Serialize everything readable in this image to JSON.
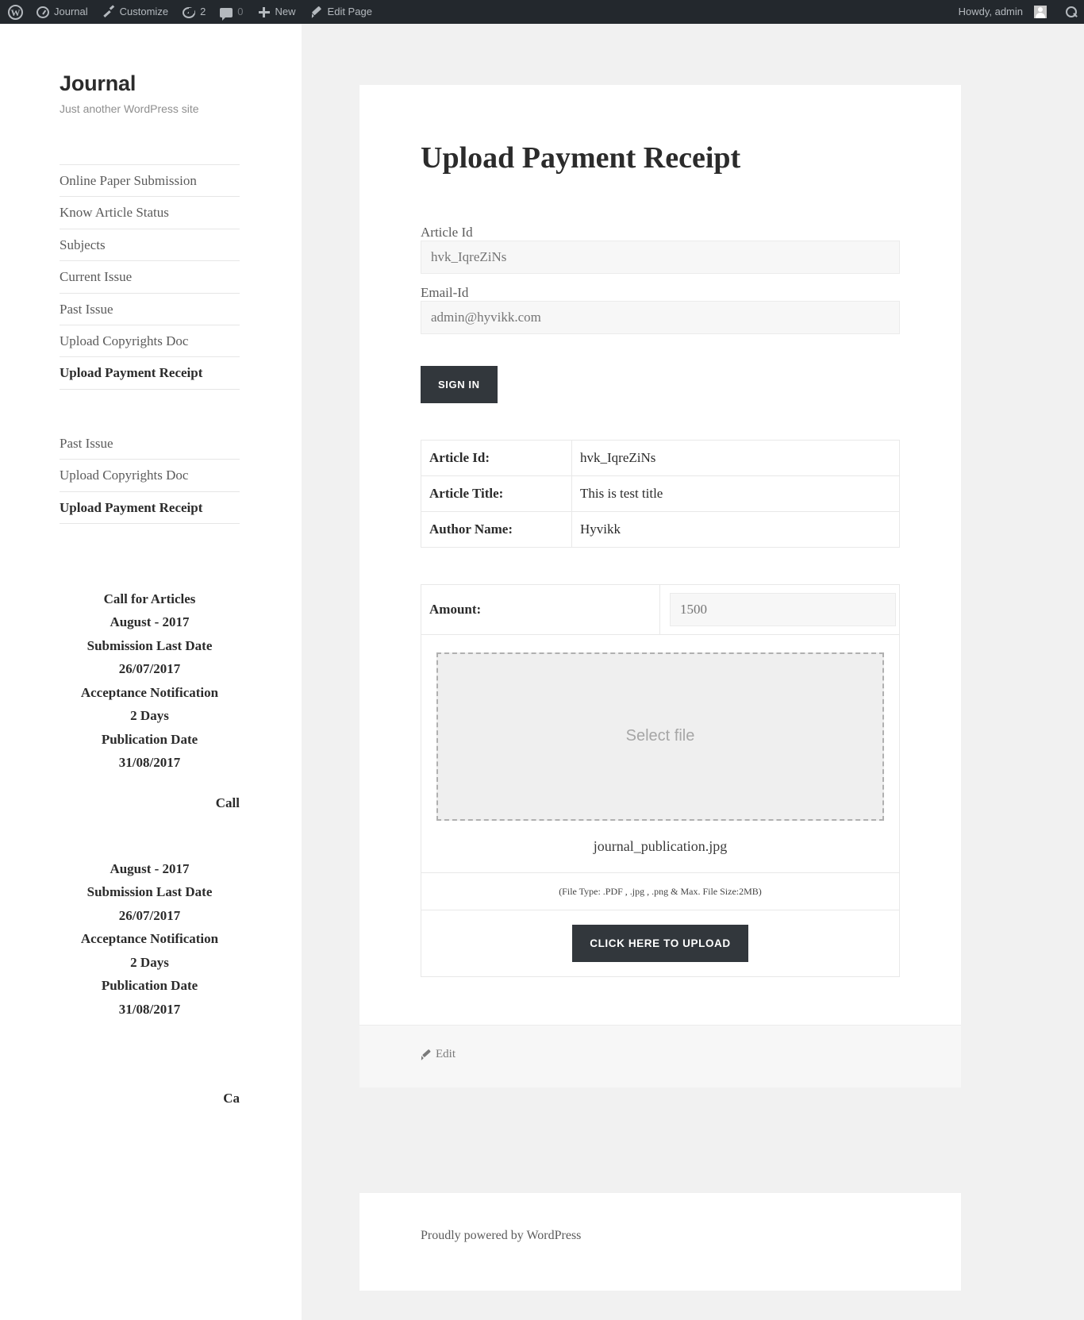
{
  "adminbar": {
    "logo_icon": "wordpress-logo-icon",
    "items": [
      {
        "icon": "dashboard-icon",
        "label": "Journal"
      },
      {
        "icon": "brush-icon",
        "label": "Customize"
      },
      {
        "icon": "update-icon",
        "label": "2"
      },
      {
        "icon": "comment-icon",
        "label": "0"
      },
      {
        "icon": "plus-icon",
        "label": "New"
      },
      {
        "icon": "pencil-icon",
        "label": "Edit Page"
      }
    ],
    "howdy": "Howdy, admin",
    "avatar_icon": "user-avatar-icon",
    "search_icon": "search-icon"
  },
  "sidebar": {
    "site_title": "Journal",
    "site_description": "Just another WordPress site",
    "nav_primary": [
      {
        "label": "Online Paper Submission",
        "current": false
      },
      {
        "label": "Know Article Status",
        "current": false
      },
      {
        "label": "Subjects",
        "current": false
      },
      {
        "label": "Current Issue",
        "current": false
      },
      {
        "label": "Past Issue",
        "current": false
      },
      {
        "label": "Upload Copyrights Doc",
        "current": false
      },
      {
        "label": "Upload Payment Receipt",
        "current": true
      }
    ],
    "nav_secondary": [
      {
        "label": "Past Issue",
        "current": false
      },
      {
        "label": "Upload Copyrights Doc",
        "current": false
      },
      {
        "label": "Upload Payment Receipt",
        "current": true
      }
    ],
    "widget_one": [
      "Call for Articles",
      "August - 2017",
      "Submission Last Date",
      "26/07/2017",
      "Acceptance Notification",
      "2 Days",
      "Publication Date",
      "31/08/2017"
    ],
    "widget_one_overflow": "Call",
    "widget_two": [
      "August - 2017",
      "Submission Last Date",
      "26/07/2017",
      "Acceptance Notification",
      "2 Days",
      "Publication Date",
      "31/08/2017"
    ],
    "widget_two_overflow": "Ca"
  },
  "main": {
    "page_title": "Upload Payment Receipt",
    "form": {
      "article_id_label": "Article Id",
      "article_id_placeholder": "hvk_IqreZiNs",
      "email_label": "Email-Id",
      "email_placeholder": "admin@hyvikk.com",
      "signin_label": "SIGN IN"
    },
    "info_table": {
      "rows": [
        {
          "key": "Article Id:",
          "value": "hvk_IqreZiNs"
        },
        {
          "key": "Article Title:",
          "value": "This is test title"
        },
        {
          "key": "Author Name:",
          "value": "Hyvikk"
        }
      ]
    },
    "upload": {
      "amount_label": "Amount:",
      "amount_placeholder": "1500",
      "dropzone_label": "Select file",
      "filename": "journal_publication.jpg",
      "note": "(File Type: .PDF , .jpg , .png & Max. File Size:2MB)",
      "upload_label": "CLICK HERE TO UPLOAD"
    },
    "edit_link": "Edit",
    "powered_by": "Proudly powered by WordPress"
  },
  "colors": {
    "adminbar_bg": "#23282d",
    "button_dark": "#32373c",
    "page_bg": "#f1f1f1",
    "muted_text": "#9a9a9a"
  }
}
